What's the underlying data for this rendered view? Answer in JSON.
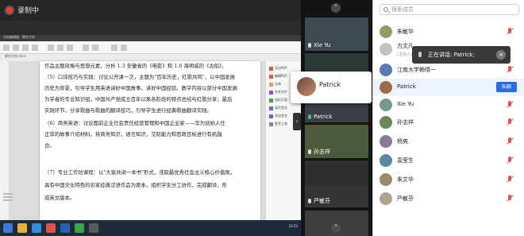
{
  "recording": {
    "label": "录制中"
  },
  "screen_share": {
    "window_title": "文档编辑器 - 教学文档",
    "tab_title": "教学文档.docx",
    "clock": "10:52",
    "paragraphs": [
      "作品主题风格与思想元素，分析 1.3 安徽省的《电影》和 1.6 海明威的《古船》。",
      "（5）口译技巧与实践：讨论公开课一次，主题为\"百年历史，红歌共鸣\"，以中国发展",
      "历史为背景，引导学生用英语讲好中国故事，讲好中国经验。教学内容以部分中国发展",
      "为学者的专业知识组，中国共产党成立百年以来各阶段的特点总结与红歌分享；最后",
      "实践环节，分享歌曲与歌曲的翻译技巧，引导学生进行经典歌曲翻译实践。",
      "（6）商务英语：讨论面前企业社会责任经营管理和中国企业家——华为创始人任",
      "正非的故事介绍材料，将商务知识，语言知识，交际能力和思政目标进行有机融",
      "合。",
      "（7）专业工作坊课程：以\"大家共讲一本书\"形式，洗取最优秀社会主义核心价值观，",
      "具有中国文化特色的名家经典汉语作品为原本，组织学生分工协作，完成翻译，形",
      "成英文版本。"
    ],
    "side_panel_items": [
      "导出PDF",
      "编辑PDF",
      "注释",
      "合并文件",
      "组织页面",
      "填写签名",
      "发送签名",
      "更多工具"
    ]
  },
  "video_tiles": [
    {
      "name": "Xie Yu",
      "muted": true
    },
    {
      "name": "",
      "muted": false
    },
    {
      "name": "Patrick",
      "muted": false
    },
    {
      "name": "孙志祥",
      "muted": true
    },
    {
      "name": "",
      "muted": false
    },
    {
      "name": "严敏芬",
      "muted": true
    },
    {
      "name": "",
      "muted": false
    }
  ],
  "hover_card": {
    "name": "Patrick"
  },
  "collapse_handle": {
    "glyph": "‹"
  },
  "search": {
    "placeholder": "搜索成员"
  },
  "speaking_banner": {
    "text": "正在讲话: Patrick;",
    "close_glyph": "×"
  },
  "participants": [
    {
      "name": "朱敏华",
      "sub": "",
      "muted": true
    },
    {
      "name": "方文凡",
      "sub": "(主持人)",
      "muted": false
    },
    {
      "name": "江南大学赖晴一",
      "sub": "",
      "muted": true
    },
    {
      "name": "Patrick",
      "sub": "",
      "muted": false,
      "selected": true,
      "private_label": "私聊"
    },
    {
      "name": "Xie Yu",
      "sub": "",
      "muted": true
    },
    {
      "name": "孙志祥",
      "sub": "",
      "muted": true
    },
    {
      "name": "杨爽",
      "sub": "",
      "muted": true
    },
    {
      "name": "袁莹生",
      "sub": "",
      "muted": true
    },
    {
      "name": "朱文华",
      "sub": "",
      "muted": true
    },
    {
      "name": "严敏芬",
      "sub": "",
      "muted": true
    }
  ],
  "colors": {
    "muted_red": "#e05353",
    "accent_blue": "#2b6ce0",
    "recording_red": "#e83a3a"
  }
}
